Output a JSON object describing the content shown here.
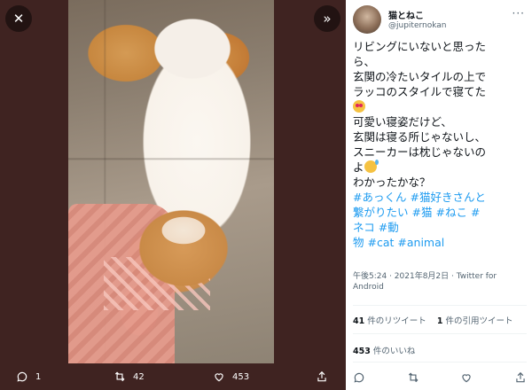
{
  "viewer": {
    "close_icon": "close-icon",
    "expand_icon": "expand-panel-icon",
    "bottom_bar": {
      "reply_count": "1",
      "retweet_count": "42",
      "like_count": "453"
    }
  },
  "tweet": {
    "user_name": "猫とねこ",
    "user_handle": "@jupiternokan",
    "text_lines": [
      "リビングにいないと思った",
      "ら、",
      "玄関の冷たいタイルの上で",
      "ラッコのスタイルで寝てた"
    ],
    "text_lines_2": [
      "可愛い寝姿だけど、",
      "玄関は寝る所じゃないし、",
      "スニーカーは枕じゃないの"
    ],
    "text_line_yo": "よ",
    "text_line_last": "わかったかな？",
    "hashtags": {
      "l1a": "#あっくん",
      "l1b": "#猫好きさんと",
      "l2a": "繋がりたい",
      "l2b": "#猫",
      "l2c": "#ねこ",
      "l2d": "#",
      "l3a": "ネコ",
      "l3b": "#動",
      "l4a": "物",
      "l4b": "#cat",
      "l4c": "#animal"
    },
    "timestamp": "午後5:24 · 2021年8月2日 · Twitter for Android",
    "retweets_count": "41",
    "retweets_label": "件のリツイート",
    "quotes_count": "1",
    "quotes_label": "件の引用ツイート",
    "likes_count": "453",
    "likes_label": "件のいいね"
  },
  "colors": {
    "viewer_bg": "#3f2321",
    "link": "#1d9bf0",
    "text": "#0f1419",
    "secondary": "#536471"
  }
}
